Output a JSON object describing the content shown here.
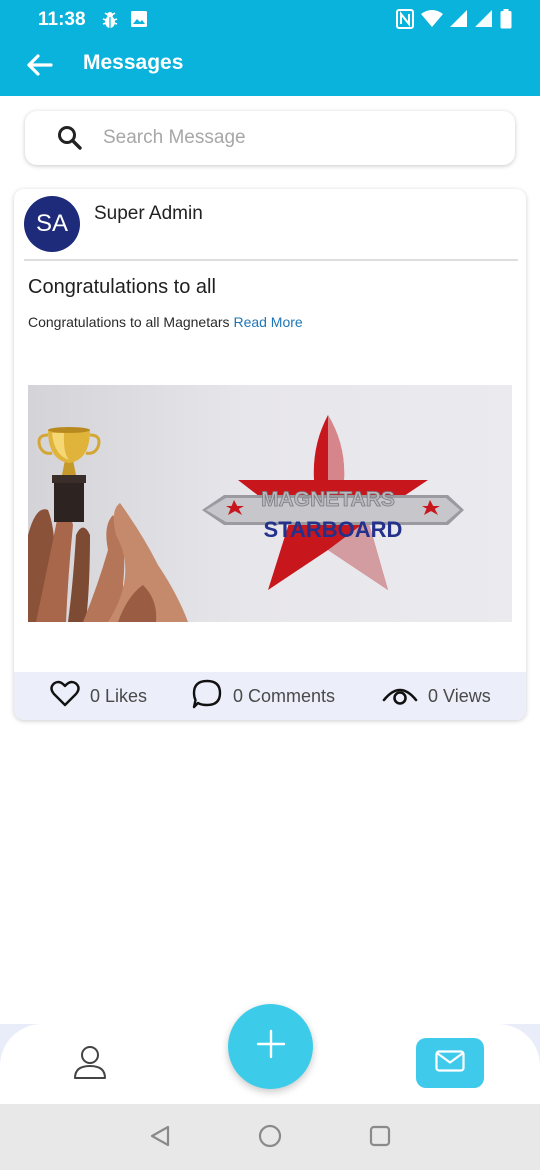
{
  "status_bar": {
    "time": "11:38",
    "icons": [
      "bug-icon",
      "image-icon",
      "nfc-icon",
      "wifi-icon",
      "signal-icon",
      "signal-icon",
      "battery-icon"
    ]
  },
  "toolbar": {
    "back_icon": "arrow-left-icon",
    "title": "Messages",
    "color": "#0ab3dc"
  },
  "search": {
    "icon": "search-icon",
    "placeholder": "Search Message",
    "value": ""
  },
  "message_card": {
    "avatar_initials": "SA",
    "avatar_color": "#1e2a7a",
    "author": "Super Admin",
    "title": "Congratulations to all",
    "excerpt": "Congratulations to all Magnetars",
    "read_more": "Read More",
    "image": {
      "line1": "MAGNETARS",
      "line2": "STARBOARD"
    },
    "stats": {
      "likes": "0 Likes",
      "comments": "0 Comments",
      "views": "0 Views"
    }
  },
  "bottom_nav": {
    "profile_icon": "user-icon",
    "fab_icon": "plus-icon",
    "messages_icon": "mail-icon",
    "accent": "#3ccce9"
  },
  "system_nav": [
    "back-triangle-icon",
    "home-circle-icon",
    "recents-square-icon"
  ]
}
